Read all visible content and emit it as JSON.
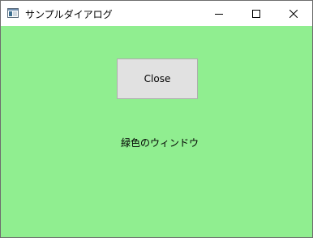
{
  "window": {
    "title": "サンプルダイアログ",
    "background_color": "#90ee90"
  },
  "titlebar": {
    "icon": "app-window-icon",
    "minimize_icon": "minimize-icon",
    "maximize_icon": "maximize-icon",
    "close_icon": "close-icon"
  },
  "content": {
    "close_button_label": "Close",
    "message": "緑色のウィンドウ"
  }
}
